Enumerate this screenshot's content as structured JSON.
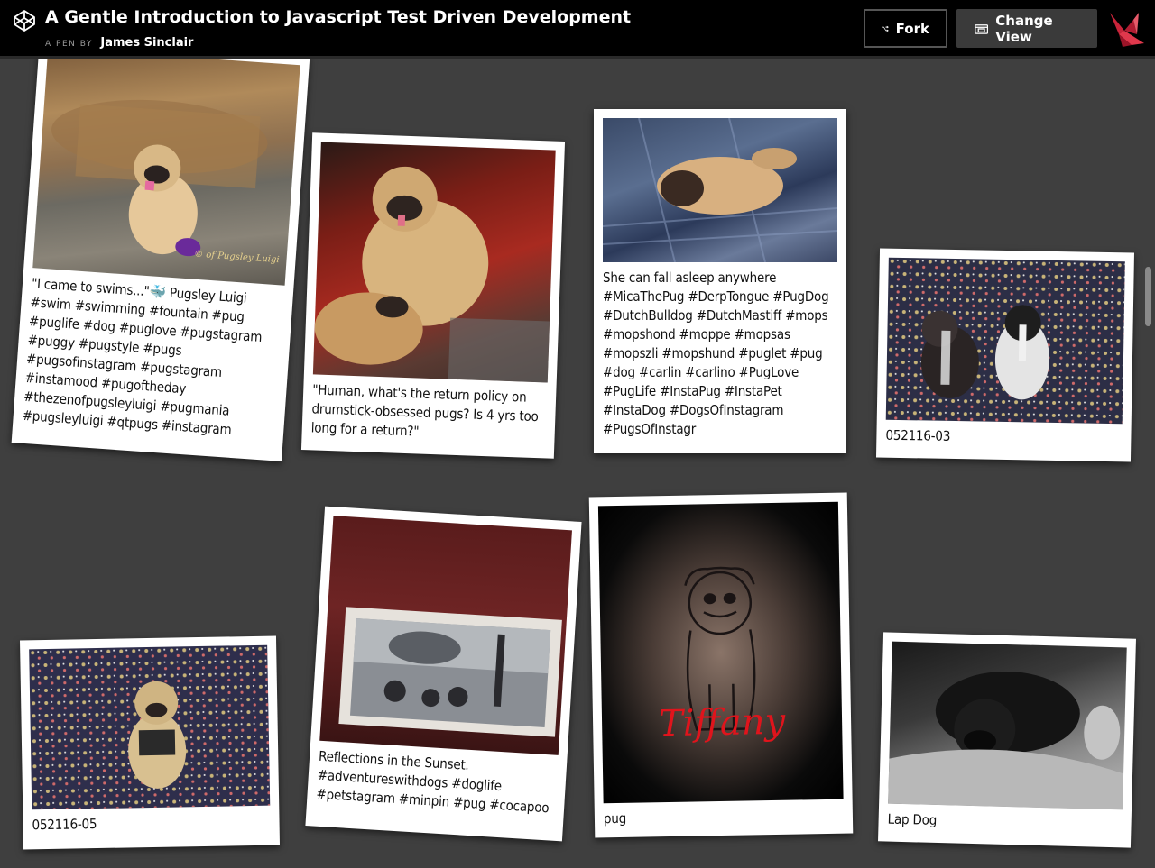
{
  "header": {
    "title": "A Gentle Introduction to Javascript Test Driven Development",
    "pen_label": "A PEN BY",
    "author": "James Sinclair",
    "fork_label": "Fork",
    "change_view_label": "Change View",
    "logo_icon": "codepen-logo-icon",
    "fork_icon": "fork-icon",
    "view_icon": "change-view-icon",
    "avatar_icon": "origami-bird-avatar"
  },
  "colors": {
    "background": "#3f3f3f",
    "header": "#000000",
    "card": "#ffffff"
  },
  "cards": [
    {
      "caption": "\"I came to swims...\"🐳 Pugsley Luigi\n#swim #swimming #fountain #pug\n#puglife #dog #puglove #pugstagram\n#puggy #pugstyle #pugs\n#pugsofinstagram #pugstagram\n#instamood #pugoftheday\n#thezenofpugsleyluigi #pugmania\n#pugsleyluigi #qtpugs #instagram",
      "watermark": "© of Pugsley Luigi"
    },
    {
      "caption": "\"Human, what's the return policy on drumstick-obsessed pugs? Is 4 yrs too long for a return?\""
    },
    {
      "caption": "She can fall asleep anywhere\n#MicaThePug #DerpTongue #PugDog\n#DutchBulldog #DutchMastiff #mops\n#mopshond #moppe #mopsas\n#mopszli #mopshund #puglet #pug\n#dog #carlin #carlino #PugLove\n#PugLife #InstaPug #InstaPet\n#InstaDog #DogsOfInstagram\n#PugsOfInstagr"
    },
    {
      "caption": "052116-03"
    },
    {
      "caption": "052116-05"
    },
    {
      "caption": "Reflections in the Sunset.\n#adventureswithdogs #doglife\n#petstagram #minpin #pug #cocapoo"
    },
    {
      "caption": "pug",
      "photo_text": "Tiffany"
    },
    {
      "caption": "Lap Dog"
    }
  ]
}
